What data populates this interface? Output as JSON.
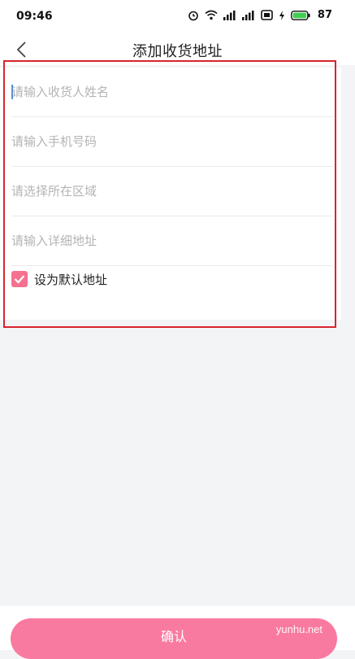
{
  "status_bar": {
    "time": "09:46",
    "battery": "87",
    "icons": [
      "alarm-icon",
      "wifi-icon",
      "signal-icon",
      "signal-icon",
      "nfc-icon",
      "charging-icon",
      "battery-icon"
    ]
  },
  "header": {
    "title": "添加收货地址",
    "back_icon": "chevron-left-icon"
  },
  "form": {
    "name_placeholder": "请输入收货人姓名",
    "phone_placeholder": "请输入手机号码",
    "region_placeholder": "请选择所在区域",
    "address_placeholder": "请输入详细地址",
    "default_label": "设为默认地址",
    "default_checked": true
  },
  "footer": {
    "confirm_label": "确认"
  },
  "watermark": "yunhu.net",
  "colors": {
    "accent": "#f5718f",
    "button": "#f97aa0",
    "highlight": "#d8242c",
    "background": "#f3f4f6"
  }
}
